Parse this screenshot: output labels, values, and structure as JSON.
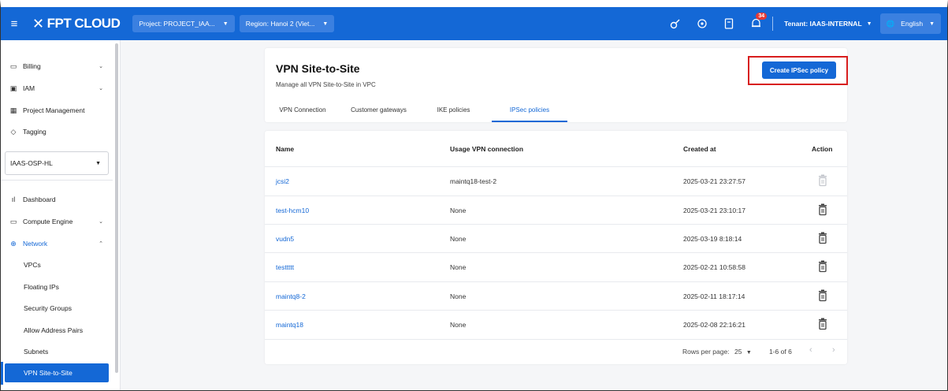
{
  "topbar": {
    "logo_text": "FPT CLOUD",
    "project_select": "Project: PROJECT_IAA...",
    "region_select": "Region: Hanoi 2 (Viet...",
    "notification_count": "34",
    "tenant": "Tenant: IAAS-INTERNAL",
    "language": "English"
  },
  "sidebar": {
    "top_items": [
      {
        "label": "Billing",
        "icon": "billing-icon"
      },
      {
        "label": "IAM",
        "icon": "iam-icon"
      },
      {
        "label": "Project Management",
        "icon": "project-icon"
      },
      {
        "label": "Tagging",
        "icon": "tag-icon"
      }
    ],
    "project_selector": "IAAS-OSP-HL",
    "main_items": [
      {
        "label": "Dashboard",
        "icon": "dashboard-icon"
      },
      {
        "label": "Compute Engine",
        "icon": "monitor-icon"
      },
      {
        "label": "Network",
        "icon": "network-icon"
      }
    ],
    "network_sub_items": [
      "VPCs",
      "Floating IPs",
      "Security Groups",
      "Allow Address Pairs",
      "Subnets",
      "VPN Site-to-Site"
    ]
  },
  "header": {
    "title": "VPN Site-to-Site",
    "subtitle": "Manage all VPN Site-to-Site in VPC",
    "create_button": "Create IPSec policy",
    "tabs": [
      "VPN Connection",
      "Customer gateways",
      "IKE policies",
      "IPSec policies"
    ],
    "active_tab": "IPSec policies"
  },
  "table": {
    "columns": [
      "Name",
      "Usage VPN connection",
      "Created at",
      "Action"
    ],
    "rows": [
      {
        "name": "jcsi2",
        "usage": "maintq18-test-2",
        "created": "2025-03-21 23:27:57",
        "deletable": false
      },
      {
        "name": "test-hcm10",
        "usage": "None",
        "created": "2025-03-21 23:10:17",
        "deletable": true
      },
      {
        "name": "vudn5",
        "usage": "None",
        "created": "2025-03-19 8:18:14",
        "deletable": true
      },
      {
        "name": "testtttt",
        "usage": "None",
        "created": "2025-02-21 10:58:58",
        "deletable": true
      },
      {
        "name": "maintq8-2",
        "usage": "None",
        "created": "2025-02-11 18:17:14",
        "deletable": true
      },
      {
        "name": "maintq18",
        "usage": "None",
        "created": "2025-02-08 22:16:21",
        "deletable": true
      }
    ],
    "footer": {
      "rows_per_page_label": "Rows per page:",
      "rows_per_page_value": "25",
      "range": "1-6 of 6"
    }
  },
  "colors": {
    "primary": "#1468d6",
    "highlight_box": "#d81e1e",
    "disabled_icon": "#b9bcc2"
  }
}
